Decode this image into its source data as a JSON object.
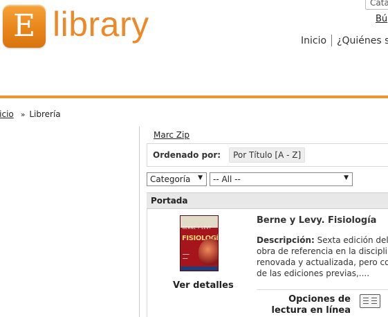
{
  "logo": {
    "letter": "E",
    "text": "library"
  },
  "header": {
    "search_box_text": "Cata",
    "search_link": "Bú",
    "nav": [
      "Inicio",
      "¿Quiénes s"
    ]
  },
  "breadcrumb": {
    "home": "Inicio",
    "arrow": "»",
    "current": "Librería"
  },
  "sidebar_link": "Marc Zip",
  "sort": {
    "label": "Ordenado por:",
    "value": "Por Título [A - Z]"
  },
  "filters": {
    "category": "Categoría",
    "category_value": "-- All --"
  },
  "table": {
    "header": "Portada"
  },
  "book": {
    "cover": {
      "title": "FISIOLOGÍA",
      "authors_top": "BERNE Y LEVY"
    },
    "title": "Berne y Levy. Fisiología",
    "description_label": "Descripción:",
    "description_lines": [
      "Sexta edición del",
      "obra de referencia en la disciplin",
      "renovada y actualizada, pero cor",
      "de las ediciones previas,...."
    ],
    "details_label": "Ver detalles",
    "reading_options": "Opciones de lectura en línea"
  },
  "colors": {
    "accent": "#ef9530",
    "logo_orange": "#ec8a2a"
  }
}
